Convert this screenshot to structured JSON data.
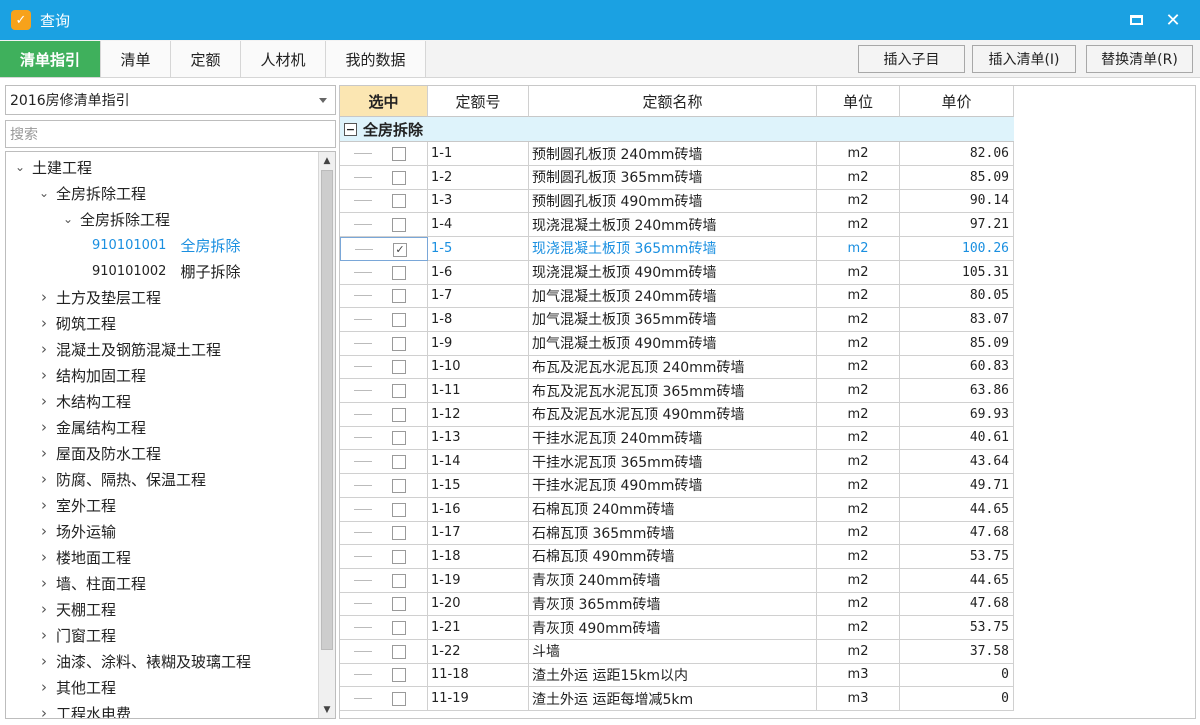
{
  "window": {
    "title": "查询",
    "app_icon": "app-logo-icon"
  },
  "tabs": [
    {
      "label": "清单指引",
      "active": true
    },
    {
      "label": "清单"
    },
    {
      "label": "定额"
    },
    {
      "label": "人材机"
    },
    {
      "label": "我的数据"
    }
  ],
  "toolbar": {
    "insert_child": "插入子目",
    "insert_list": "插入清单(I)",
    "replace_list": "替换清单(R)"
  },
  "left": {
    "combo_value": "2016房修清单指引",
    "search_placeholder": "搜索",
    "tree": [
      {
        "level": 0,
        "expander": "down",
        "label": "土建工程"
      },
      {
        "level": 1,
        "expander": "down",
        "label": "全房拆除工程"
      },
      {
        "level": 2,
        "expander": "down",
        "label": "全房拆除工程"
      },
      {
        "level": 3,
        "expander": "none",
        "code": "910101001",
        "label": "全房拆除",
        "selected": true
      },
      {
        "level": 3,
        "expander": "none",
        "code": "910101002",
        "label": "棚子拆除"
      },
      {
        "level": 1,
        "expander": "right",
        "label": "土方及垫层工程"
      },
      {
        "level": 1,
        "expander": "right",
        "label": "砌筑工程"
      },
      {
        "level": 1,
        "expander": "right",
        "label": "混凝土及钢筋混凝土工程"
      },
      {
        "level": 1,
        "expander": "right",
        "label": "结构加固工程"
      },
      {
        "level": 1,
        "expander": "right",
        "label": "木结构工程"
      },
      {
        "level": 1,
        "expander": "right",
        "label": "金属结构工程"
      },
      {
        "level": 1,
        "expander": "right",
        "label": "屋面及防水工程"
      },
      {
        "level": 1,
        "expander": "right",
        "label": "防腐、隔热、保温工程"
      },
      {
        "level": 1,
        "expander": "right",
        "label": "室外工程"
      },
      {
        "level": 1,
        "expander": "right",
        "label": "场外运输"
      },
      {
        "level": 1,
        "expander": "right",
        "label": "楼地面工程"
      },
      {
        "level": 1,
        "expander": "right",
        "label": "墙、柱面工程"
      },
      {
        "level": 1,
        "expander": "right",
        "label": "天棚工程"
      },
      {
        "level": 1,
        "expander": "right",
        "label": "门窗工程"
      },
      {
        "level": 1,
        "expander": "right",
        "label": "油漆、涂料、裱糊及玻璃工程"
      },
      {
        "level": 1,
        "expander": "right",
        "label": "其他工程"
      },
      {
        "level": 1,
        "expander": "right",
        "label": "工程水电费"
      }
    ]
  },
  "grid": {
    "headers": {
      "select": "选中",
      "code": "定额号",
      "name": "定额名称",
      "unit": "单位",
      "price": "单价"
    },
    "group_label": "全房拆除",
    "rows": [
      {
        "code": "1-1",
        "name": "预制圆孔板顶 240mm砖墙",
        "unit": "m2",
        "price": "82.06",
        "checked": false
      },
      {
        "code": "1-2",
        "name": "预制圆孔板顶 365mm砖墙",
        "unit": "m2",
        "price": "85.09",
        "checked": false
      },
      {
        "code": "1-3",
        "name": "预制圆孔板顶 490mm砖墙",
        "unit": "m2",
        "price": "90.14",
        "checked": false
      },
      {
        "code": "1-4",
        "name": "现浇混凝土板顶 240mm砖墙",
        "unit": "m2",
        "price": "97.21",
        "checked": false
      },
      {
        "code": "1-5",
        "name": "现浇混凝土板顶 365mm砖墙",
        "unit": "m2",
        "price": "100.26",
        "checked": true,
        "active": true
      },
      {
        "code": "1-6",
        "name": "现浇混凝土板顶 490mm砖墙",
        "unit": "m2",
        "price": "105.31",
        "checked": false
      },
      {
        "code": "1-7",
        "name": "加气混凝土板顶 240mm砖墙",
        "unit": "m2",
        "price": "80.05",
        "checked": false
      },
      {
        "code": "1-8",
        "name": "加气混凝土板顶 365mm砖墙",
        "unit": "m2",
        "price": "83.07",
        "checked": false
      },
      {
        "code": "1-9",
        "name": "加气混凝土板顶 490mm砖墙",
        "unit": "m2",
        "price": "85.09",
        "checked": false
      },
      {
        "code": "1-10",
        "name": "布瓦及泥瓦水泥瓦顶 240mm砖墙",
        "unit": "m2",
        "price": "60.83",
        "checked": false
      },
      {
        "code": "1-11",
        "name": "布瓦及泥瓦水泥瓦顶 365mm砖墙",
        "unit": "m2",
        "price": "63.86",
        "checked": false
      },
      {
        "code": "1-12",
        "name": "布瓦及泥瓦水泥瓦顶 490mm砖墙",
        "unit": "m2",
        "price": "69.93",
        "checked": false
      },
      {
        "code": "1-13",
        "name": "干挂水泥瓦顶 240mm砖墙",
        "unit": "m2",
        "price": "40.61",
        "checked": false
      },
      {
        "code": "1-14",
        "name": "干挂水泥瓦顶 365mm砖墙",
        "unit": "m2",
        "price": "43.64",
        "checked": false
      },
      {
        "code": "1-15",
        "name": "干挂水泥瓦顶 490mm砖墙",
        "unit": "m2",
        "price": "49.71",
        "checked": false
      },
      {
        "code": "1-16",
        "name": "石棉瓦顶 240mm砖墙",
        "unit": "m2",
        "price": "44.65",
        "checked": false
      },
      {
        "code": "1-17",
        "name": "石棉瓦顶 365mm砖墙",
        "unit": "m2",
        "price": "47.68",
        "checked": false
      },
      {
        "code": "1-18",
        "name": "石棉瓦顶 490mm砖墙",
        "unit": "m2",
        "price": "53.75",
        "checked": false
      },
      {
        "code": "1-19",
        "name": "青灰顶 240mm砖墙",
        "unit": "m2",
        "price": "44.65",
        "checked": false
      },
      {
        "code": "1-20",
        "name": "青灰顶 365mm砖墙",
        "unit": "m2",
        "price": "47.68",
        "checked": false
      },
      {
        "code": "1-21",
        "name": "青灰顶 490mm砖墙",
        "unit": "m2",
        "price": "53.75",
        "checked": false
      },
      {
        "code": "1-22",
        "name": "斗墙",
        "unit": "m2",
        "price": "37.58",
        "checked": false
      },
      {
        "code": "11-18",
        "name": "渣土外运 运距15km以内",
        "unit": "m3",
        "price": "0",
        "checked": false
      },
      {
        "code": "11-19",
        "name": "渣土外运 运距每增减5km",
        "unit": "m3",
        "price": "0",
        "checked": false
      }
    ]
  },
  "colors": {
    "titlebar": "#1ba1e2",
    "active_tab": "#3fb05c",
    "selected_text": "#1a8fe0",
    "header_selected": "#fbe6b2",
    "group_row": "#def3fb"
  }
}
